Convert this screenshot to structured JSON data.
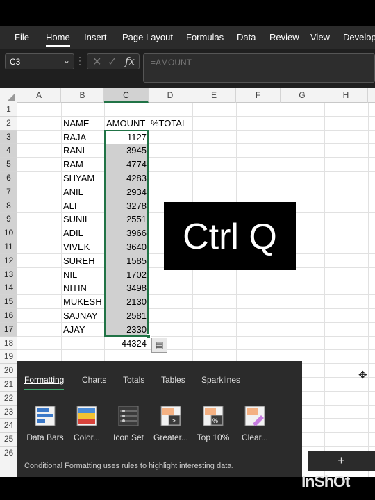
{
  "ribbon_tabs": [
    "File",
    "Home",
    "Insert",
    "Page Layout",
    "Formulas",
    "Data",
    "Review",
    "View",
    "Develop"
  ],
  "active_tab": "Home",
  "name_box": "C3",
  "formula_bar": {
    "value": "=AMOUNT",
    "cancel_icon": "x-icon",
    "enter_icon": "check-icon",
    "fx_label": "fx"
  },
  "columns": [
    "A",
    "B",
    "C",
    "D",
    "E",
    "F",
    "G",
    "H"
  ],
  "rows": [
    "1",
    "2",
    "3",
    "4",
    "5",
    "6",
    "7",
    "8",
    "9",
    "10",
    "11",
    "12",
    "13",
    "14",
    "15",
    "16",
    "17",
    "18",
    "19",
    "20",
    "21",
    "22",
    "23",
    "24",
    "25",
    "26"
  ],
  "headers": {
    "name": "NAME",
    "amount": "AMOUNT",
    "percent": "%TOTAL"
  },
  "data_rows": [
    {
      "name": "RAJA",
      "amount": "1127"
    },
    {
      "name": "RANI",
      "amount": "3945"
    },
    {
      "name": "RAM",
      "amount": "4774"
    },
    {
      "name": "SHYAM",
      "amount": "4283"
    },
    {
      "name": "ANIL",
      "amount": "2934"
    },
    {
      "name": "ALI",
      "amount": "3278"
    },
    {
      "name": "SUNIL",
      "amount": "2551"
    },
    {
      "name": "ADIL",
      "amount": "3966"
    },
    {
      "name": "VIVEK",
      "amount": "3640"
    },
    {
      "name": "SUREH",
      "amount": "1585"
    },
    {
      "name": "NIL",
      "amount": "1702"
    },
    {
      "name": "NITIN",
      "amount": "3498"
    },
    {
      "name": "MUKESH",
      "amount": "2130"
    },
    {
      "name": "SAJNAY",
      "amount": "2581"
    },
    {
      "name": "AJAY",
      "amount": "2330"
    }
  ],
  "total": "44324",
  "overlay_text": "Ctrl Q",
  "quick_analysis": {
    "tabs": [
      "Formatting",
      "Charts",
      "Totals",
      "Tables",
      "Sparklines"
    ],
    "active_tab": "Formatting",
    "options": [
      "Data Bars",
      "Color...",
      "Icon Set",
      "Greater...",
      "Top 10%",
      "Clear..."
    ],
    "description": "Conditional Formatting uses rules to highlight interesting data."
  },
  "add_sheet_label": "+",
  "watermark": "InShOt",
  "colors": {
    "accent_green": "#217346",
    "selection_gray": "#d0d0d0",
    "dark_chrome": "#2b2b2b"
  }
}
